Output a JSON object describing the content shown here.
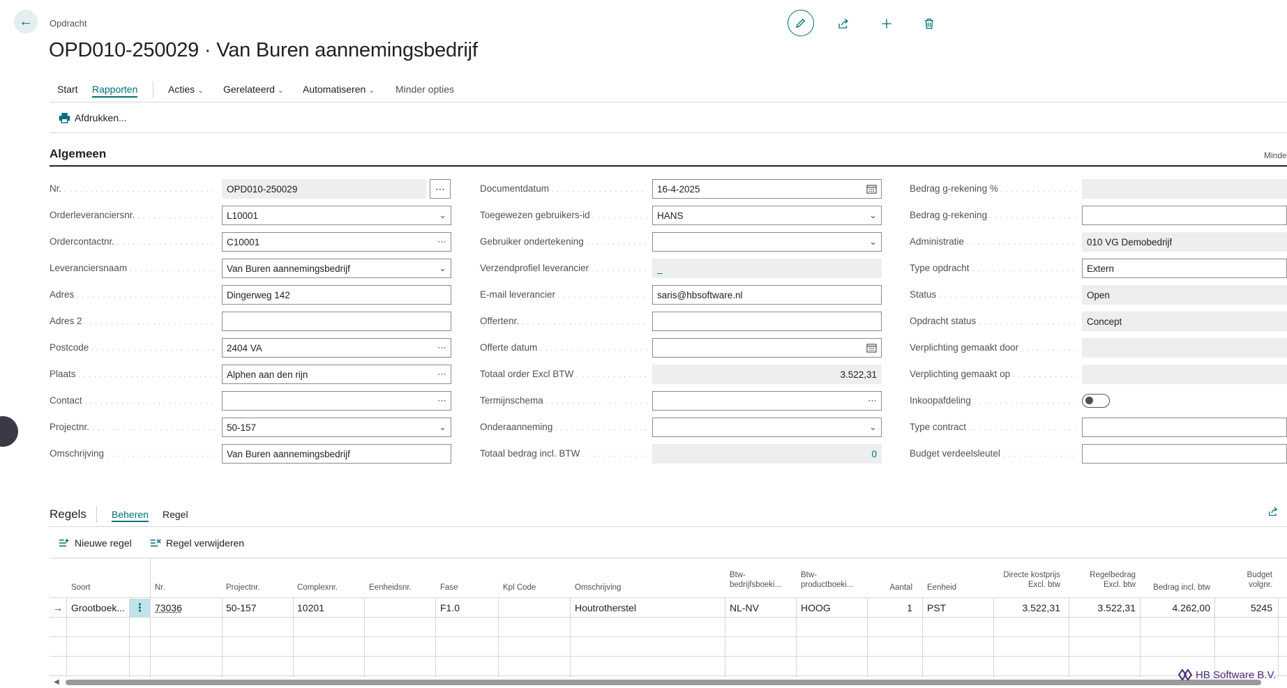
{
  "header": {
    "breadcrumb": "Opdracht",
    "title": "OPD010-250029 · Van Buren aannemingsbedrijf"
  },
  "menu": {
    "start": "Start",
    "rapporten": "Rapporten",
    "acties": "Acties",
    "gerelateerd": "Gerelateerd",
    "automatiseren": "Automatiseren",
    "minder_opties": "Minder opties",
    "print": "Afdrukken..."
  },
  "section": {
    "title": "Algemeen",
    "minder": "Minde"
  },
  "col1": [
    {
      "label": "Nr.",
      "value": "OPD010-250029"
    },
    {
      "label": "Orderleveranciersnr.",
      "value": "L10001"
    },
    {
      "label": "Ordercontactnr.",
      "value": "C10001"
    },
    {
      "label": "Leveranciersnaam",
      "value": "Van Buren aannemingsbedrijf"
    },
    {
      "label": "Adres",
      "value": "Dingerweg 142"
    },
    {
      "label": "Adres 2",
      "value": ""
    },
    {
      "label": "Postcode",
      "value": "2404 VA"
    },
    {
      "label": "Plaats",
      "value": "Alphen aan den rijn"
    },
    {
      "label": "Contact",
      "value": ""
    },
    {
      "label": "Projectnr.",
      "value": "50-157"
    },
    {
      "label": "Omschrijving",
      "value": "Van Buren aannemingsbedrijf"
    }
  ],
  "col2": [
    {
      "label": "Documentdatum",
      "value": "16-4-2025"
    },
    {
      "label": "Toegewezen gebruikers-id",
      "value": "HANS"
    },
    {
      "label": "Gebruiker ondertekening",
      "value": ""
    },
    {
      "label": "Verzendprofiel leverancier",
      "value": "_"
    },
    {
      "label": "E-mail leverancier",
      "value": "saris@hbsoftware.nl"
    },
    {
      "label": "Offertenr.",
      "value": ""
    },
    {
      "label": "Offerte datum",
      "value": ""
    },
    {
      "label": "Totaal order Excl BTW",
      "value": "3.522,31"
    },
    {
      "label": "Termijnschema",
      "value": ""
    },
    {
      "label": "Onderaanneming",
      "value": ""
    },
    {
      "label": "Totaal bedrag incl. BTW",
      "value": "0"
    }
  ],
  "col3": [
    {
      "label": "Bedrag g-rekening %",
      "value": ""
    },
    {
      "label": "Bedrag g-rekening",
      "value": ""
    },
    {
      "label": "Administratie",
      "value": "010 VG Demobedrijf"
    },
    {
      "label": "Type opdracht",
      "value": "Extern"
    },
    {
      "label": "Status",
      "value": "Open"
    },
    {
      "label": "Opdracht status",
      "value": "Concept"
    },
    {
      "label": "Verplichting gemaakt door",
      "value": ""
    },
    {
      "label": "Verplichting gemaakt op",
      "value": ""
    },
    {
      "label": "Inkoopafdeling",
      "value": ""
    },
    {
      "label": "Type contract",
      "value": ""
    },
    {
      "label": "Budget verdeelsleutel",
      "value": ""
    }
  ],
  "lines": {
    "title": "Regels",
    "tab_beheren": "Beheren",
    "tab_regel": "Regel",
    "new_line": "Nieuwe regel",
    "delete_line": "Regel verwijderen",
    "headers": {
      "soort": "Soort",
      "nr": "Nr.",
      "projectnr": "Projectnr.",
      "complexnr": "Complexnr.",
      "eenheidsnr": "Eenheidsnr.",
      "fase": "Fase",
      "kpl": "Kpl Code",
      "omschrijving": "Omschrijving",
      "btw_bedrijf_1": "Btw-",
      "btw_bedrijf_2": "bedrijfsboeki...",
      "btw_product_1": "Btw-",
      "btw_product_2": "productboeki...",
      "aantal": "Aantal",
      "eenheid": "Eenheid",
      "directe_1": "Directe kostprijs",
      "directe_2": "Excl. btw",
      "regelbedrag_1": "Regelbedrag",
      "regelbedrag_2": "Excl. btw",
      "incl": "Bedrag incl. btw",
      "budget_1": "Budget",
      "budget_2": "volgnr."
    },
    "row": {
      "soort": "Grootboek...",
      "nr": "73036",
      "projectnr": "50-157",
      "complexnr": "10201",
      "eenheidsnr": "",
      "fase": "F1.0",
      "kpl": "",
      "omschrijving": "Houtrotherstel",
      "btw_bedrijf": "NL-NV",
      "btw_product": "HOOG",
      "aantal": "1",
      "eenheid": "PST",
      "directe": "3.522,31",
      "regelbedrag": "3.522,31",
      "incl": "4.262,00",
      "budget": "5245"
    }
  },
  "watermark": "HB Software B.V.",
  "colors": {
    "accent": "#00707a",
    "readonly": "#eceeef"
  }
}
